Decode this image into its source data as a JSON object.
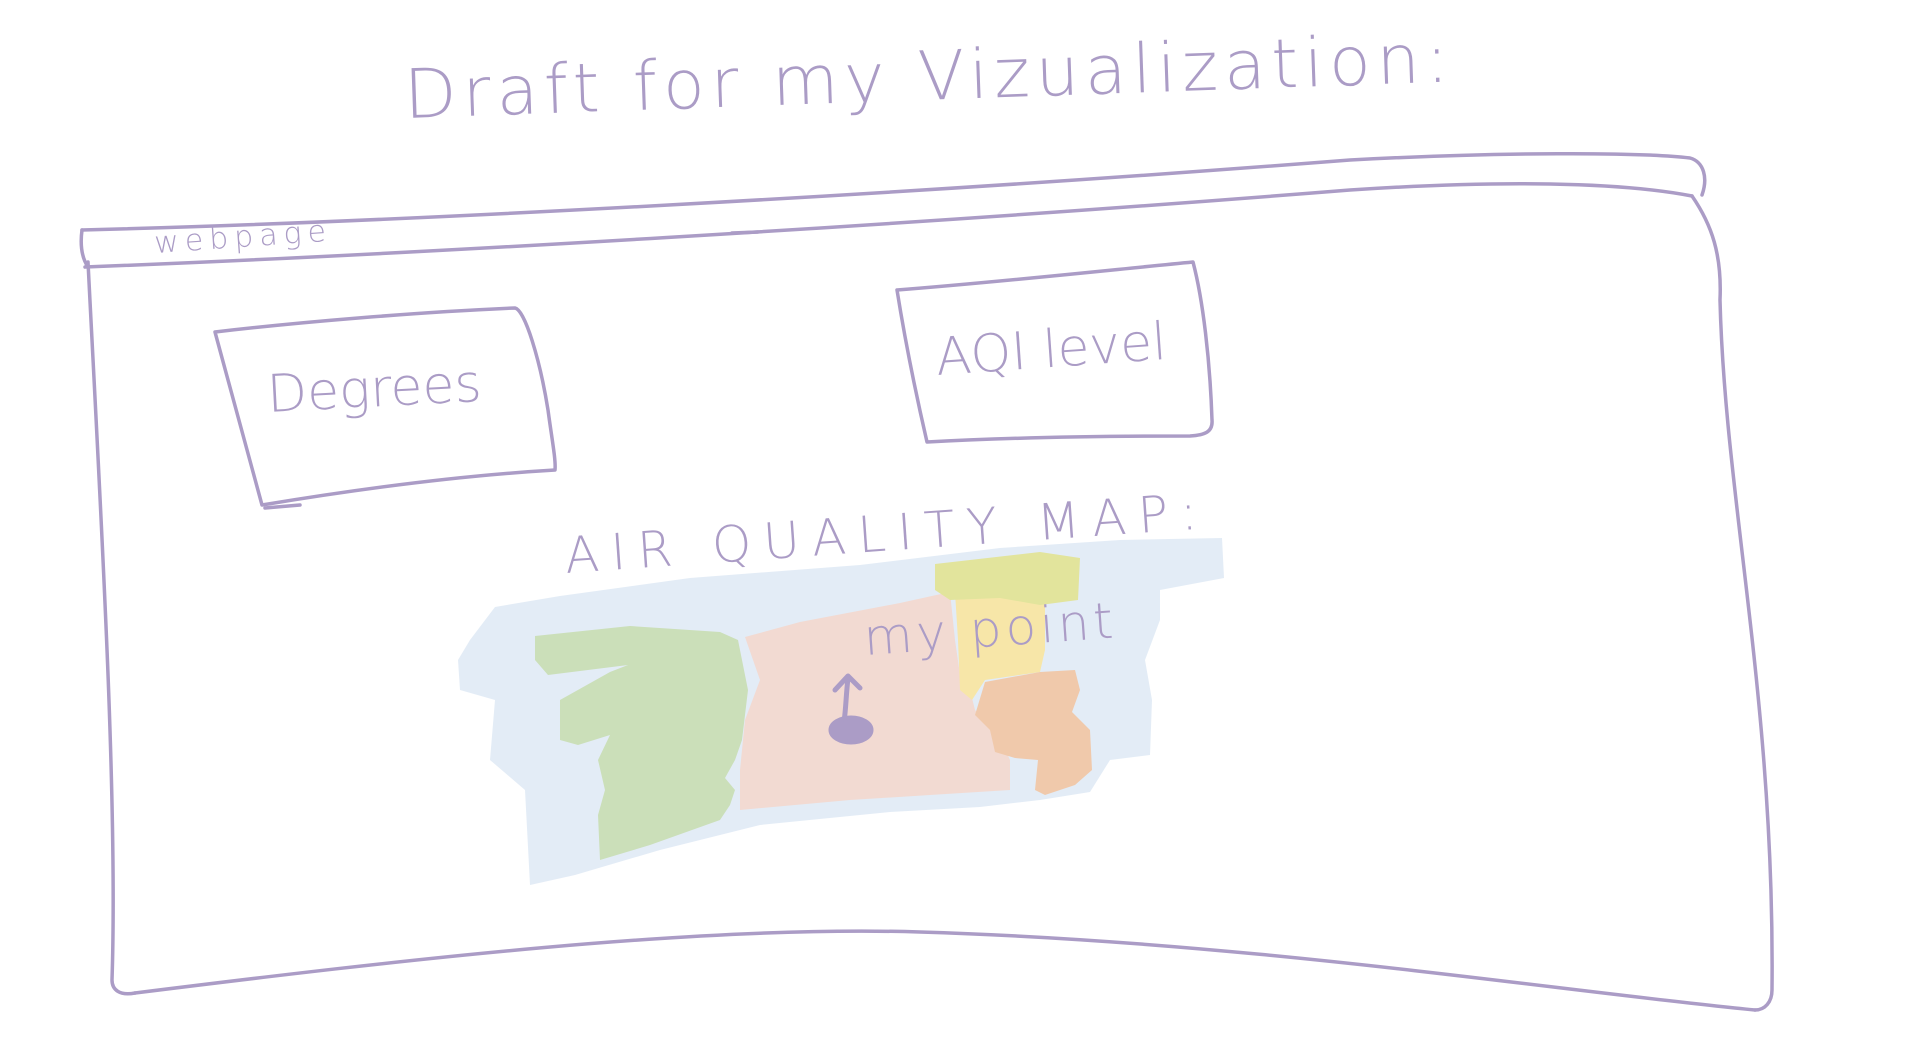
{
  "sketch": {
    "title": "Draft for my Vizualization:",
    "window_tab_label": "webpage",
    "degrees_box_label": "Degrees",
    "aqi_box_label": "AQI level",
    "map_title": "AIR QUALITY MAP:",
    "map_point_label": "my point"
  },
  "colors": {
    "ink": "#ab9cc6",
    "water": "#e1ebf5",
    "green_region": "#cbdfb9",
    "pink_region": "#f2dad2",
    "yellow_region": "#f7e6a8",
    "yellow_green_region": "#e2e49c",
    "orange_region": "#f0c9ab"
  },
  "map_regions": [
    {
      "name": "water",
      "color_key": "water"
    },
    {
      "name": "green-region",
      "color_key": "green_region"
    },
    {
      "name": "pink-region",
      "color_key": "pink_region"
    },
    {
      "name": "yellow-region",
      "color_key": "yellow_region"
    },
    {
      "name": "yellow-green-region",
      "color_key": "yellow_green_region"
    },
    {
      "name": "orange-region",
      "color_key": "orange_region"
    }
  ]
}
